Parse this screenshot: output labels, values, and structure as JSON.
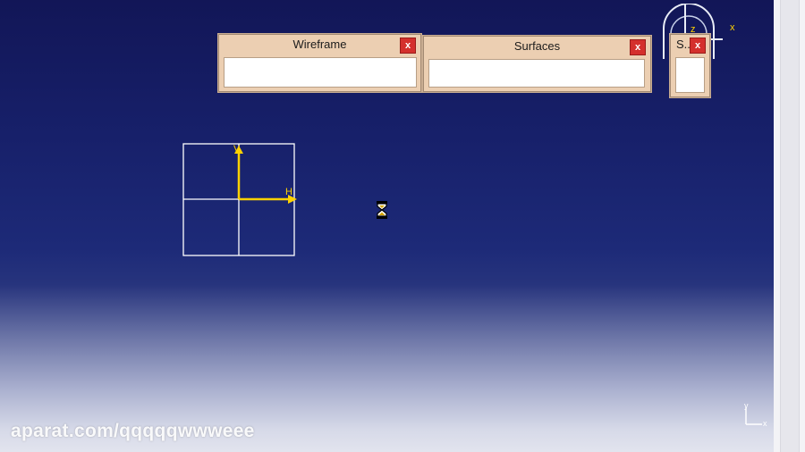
{
  "toolbars": {
    "wireframe": {
      "title": "Wireframe",
      "close": "x"
    },
    "surfaces": {
      "title": "Surfaces",
      "close": "x"
    },
    "third": {
      "title": "S..",
      "close": "x"
    }
  },
  "sketch_grid": {
    "v_label": "V",
    "h_label": "H"
  },
  "compass": {
    "z_label": "z",
    "x_label": "x"
  },
  "axis_indicator": {
    "y_label": "y",
    "x_label": "x"
  },
  "watermark": "aparat.com/qqqqqwwweee",
  "colors": {
    "background_top": "#121657",
    "background_bottom": "#e2e4ee",
    "toolbar": "#eccfb2",
    "close_button": "#d4302d",
    "axis_yellow": "#ffd200"
  },
  "icons": {
    "cursor": "hourglass-icon",
    "compass": "compass-icon",
    "axis": "axis-indicator-icon"
  }
}
